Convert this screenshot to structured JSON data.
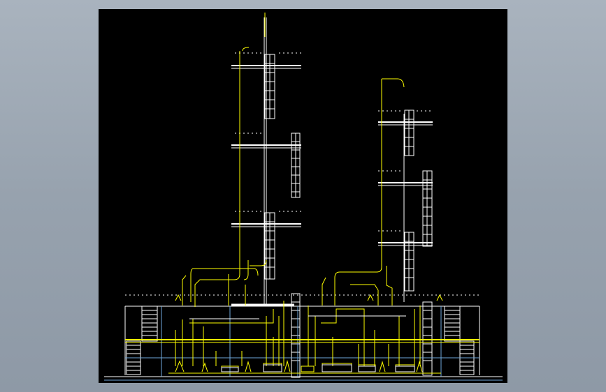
{
  "viewer": {
    "background_color": "#9aa5b1",
    "canvas_color": "#000000"
  },
  "drawing": {
    "line_colors": {
      "structure": "#ffffff",
      "piping": "#ffff00",
      "grid": "#6fa8dc"
    }
  }
}
